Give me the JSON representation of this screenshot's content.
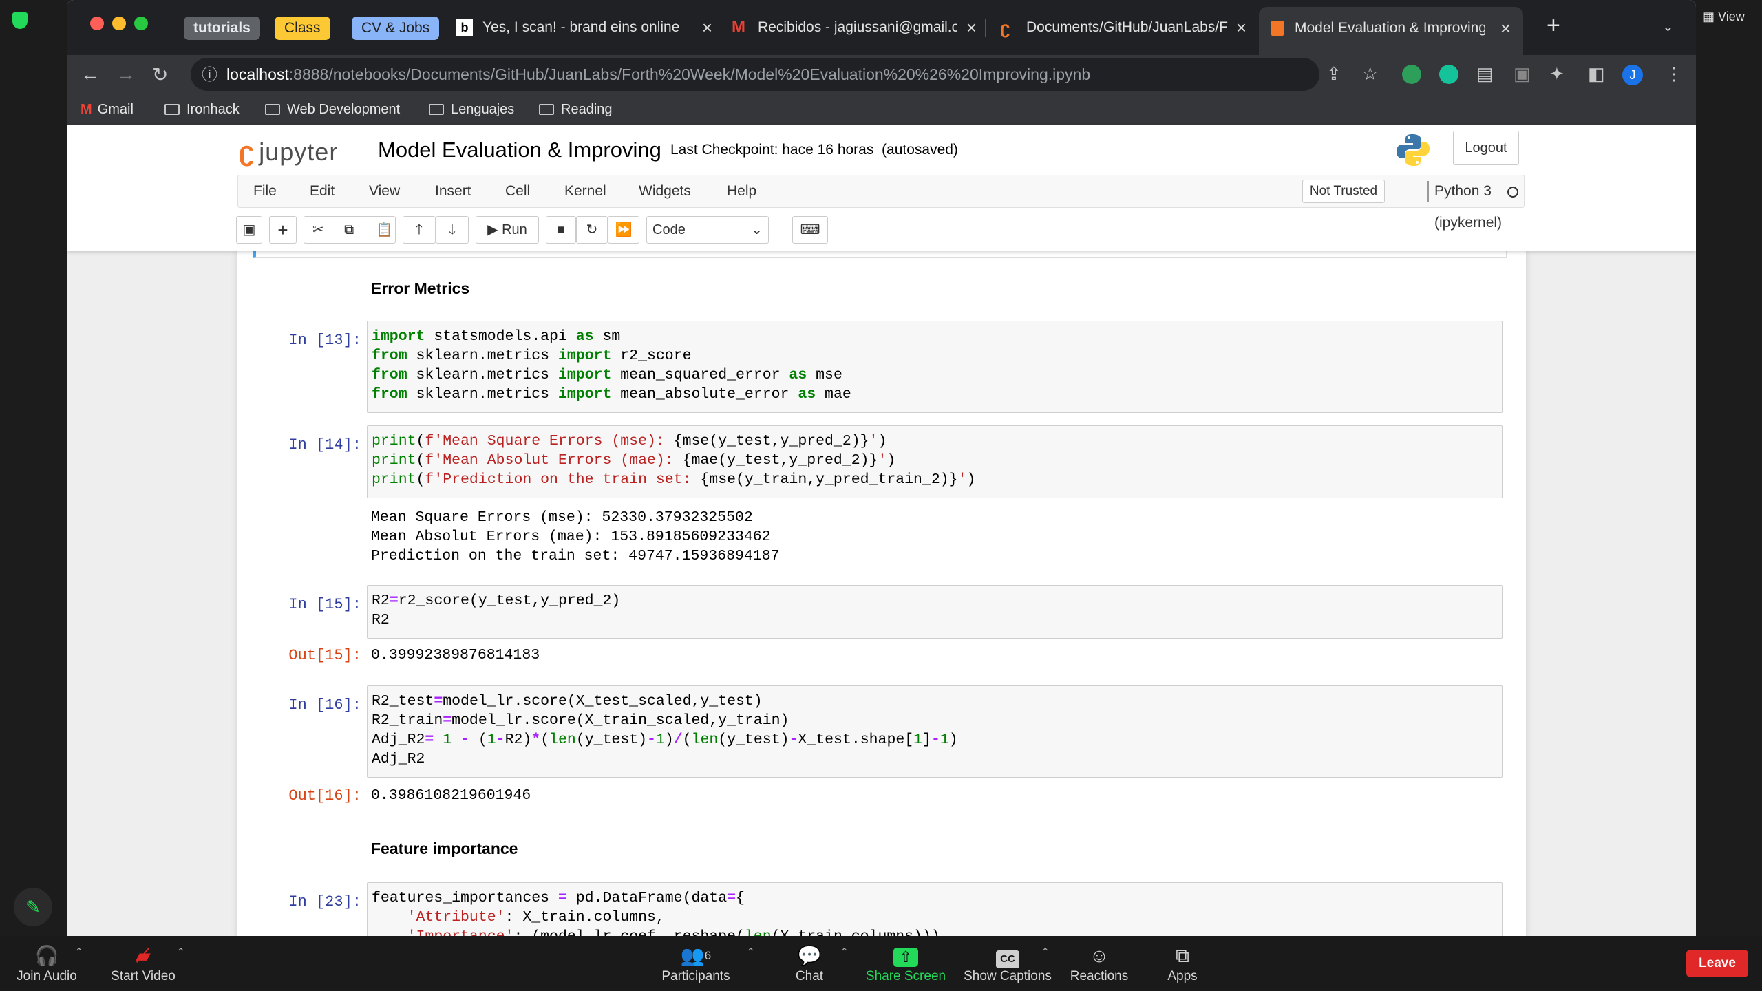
{
  "browser": {
    "pinned_tabs": [
      {
        "label": "tutorials",
        "bg": "#5f6368",
        "fg": "#e8eaed"
      },
      {
        "label": "Class",
        "bg": "#fcc934",
        "fg": "#202124"
      },
      {
        "label": "CV & Jobs",
        "bg": "#8ab4f8",
        "fg": "#202124"
      }
    ],
    "tabs": [
      {
        "title": "Yes, I scan! - brand eins online",
        "icon": "b"
      },
      {
        "title": "Recibidos - jagiussani@gmail.c",
        "icon": "M"
      },
      {
        "title": "Documents/GitHub/JuanLabs/F",
        "icon": "jupyter-icon"
      },
      {
        "title": "Model Evaluation & Improving",
        "icon": "notebook-icon"
      }
    ],
    "url_host": "localhost",
    "url_rest": ":8888/notebooks/Documents/GitHub/JuanLabs/Forth%20Week/Model%20Evaluation%20%26%20Improving.ipynb",
    "bookmarks": [
      "Gmail",
      "Ironhack",
      "Web Development",
      "Lenguajes",
      "Reading"
    ],
    "avatar_letter": "J"
  },
  "jupyter": {
    "logo_text": "jupyter",
    "notebook_title": "Model Evaluation & Improving",
    "checkpoint": "Last Checkpoint: hace 16 horas  (autosaved)",
    "logout": "Logout",
    "menu": [
      "File",
      "Edit",
      "View",
      "Insert",
      "Cell",
      "Kernel",
      "Widgets",
      "Help"
    ],
    "trust": "Not Trusted",
    "kernel": "Python 3 (ipykernel)",
    "toolbar": {
      "run": "Run",
      "cell_type": "Code"
    }
  },
  "notebook": {
    "heading_error": "Error Metrics",
    "heading_feature": "Feature importance",
    "prompts": {
      "in13": "In [13]:",
      "in14": "In [14]:",
      "in15": "In [15]:",
      "out15": "Out[15]:",
      "in16": "In [16]:",
      "out16": "Out[16]:",
      "in23": "In [23]:"
    },
    "outputs": {
      "o14_1": "Mean Square Errors (mse): 52330.37932325502",
      "o14_2": "Mean Absolut Errors (mae): 153.89185609233462",
      "o14_3": "Prediction on the train set: 49747.15936894187",
      "o15": "0.39992389876814183",
      "o16": "0.3986108219601946"
    }
  },
  "zoom": {
    "join_audio": "Join Audio",
    "start_video": "Start Video",
    "participants": "Participants",
    "participants_count": "6",
    "chat": "Chat",
    "share_screen": "Share Screen",
    "show_captions": "Show Captions",
    "reactions": "Reactions",
    "apps": "Apps",
    "leave": "Leave",
    "view": "View"
  },
  "colors": {
    "zoom_share": "#23d959",
    "zoom_leave": "#e02828",
    "jupyter_orange": "#f37626"
  }
}
